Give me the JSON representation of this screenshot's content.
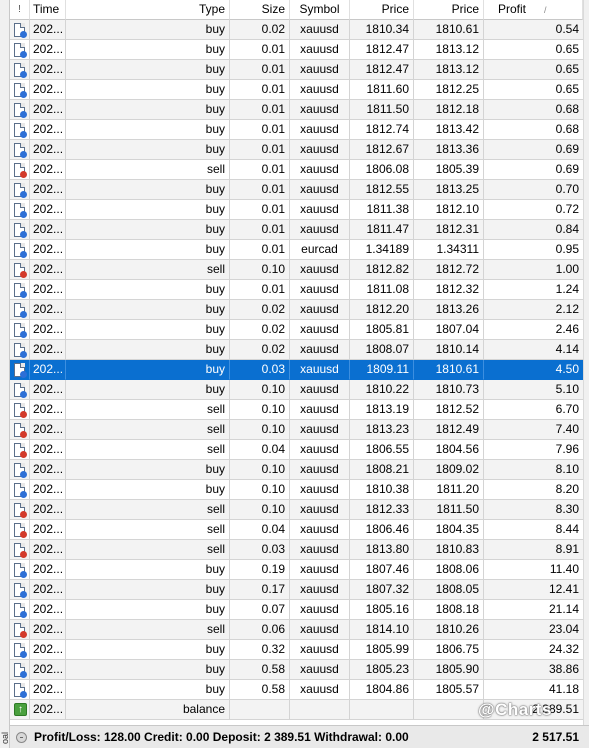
{
  "columns": {
    "icon": "!",
    "time": "Time",
    "type": "Type",
    "size": "Size",
    "symbol": "Symbol",
    "price_open": "Price",
    "price_close": "Price",
    "profit": "Profit"
  },
  "sort_indicator": "/",
  "selected_row_index": 17,
  "rows": [
    {
      "kind": "buy",
      "time": "202...",
      "type": "buy",
      "size": "0.02",
      "symbol": "xauusd",
      "price_open": "1810.34",
      "price_close": "1810.61",
      "profit": "0.54"
    },
    {
      "kind": "buy",
      "time": "202...",
      "type": "buy",
      "size": "0.01",
      "symbol": "xauusd",
      "price_open": "1812.47",
      "price_close": "1813.12",
      "profit": "0.65"
    },
    {
      "kind": "buy",
      "time": "202...",
      "type": "buy",
      "size": "0.01",
      "symbol": "xauusd",
      "price_open": "1812.47",
      "price_close": "1813.12",
      "profit": "0.65"
    },
    {
      "kind": "buy",
      "time": "202...",
      "type": "buy",
      "size": "0.01",
      "symbol": "xauusd",
      "price_open": "1811.60",
      "price_close": "1812.25",
      "profit": "0.65"
    },
    {
      "kind": "buy",
      "time": "202...",
      "type": "buy",
      "size": "0.01",
      "symbol": "xauusd",
      "price_open": "1811.50",
      "price_close": "1812.18",
      "profit": "0.68"
    },
    {
      "kind": "buy",
      "time": "202...",
      "type": "buy",
      "size": "0.01",
      "symbol": "xauusd",
      "price_open": "1812.74",
      "price_close": "1813.42",
      "profit": "0.68"
    },
    {
      "kind": "buy",
      "time": "202...",
      "type": "buy",
      "size": "0.01",
      "symbol": "xauusd",
      "price_open": "1812.67",
      "price_close": "1813.36",
      "profit": "0.69"
    },
    {
      "kind": "sell",
      "time": "202...",
      "type": "sell",
      "size": "0.01",
      "symbol": "xauusd",
      "price_open": "1806.08",
      "price_close": "1805.39",
      "profit": "0.69"
    },
    {
      "kind": "buy",
      "time": "202...",
      "type": "buy",
      "size": "0.01",
      "symbol": "xauusd",
      "price_open": "1812.55",
      "price_close": "1813.25",
      "profit": "0.70"
    },
    {
      "kind": "buy",
      "time": "202...",
      "type": "buy",
      "size": "0.01",
      "symbol": "xauusd",
      "price_open": "1811.38",
      "price_close": "1812.10",
      "profit": "0.72"
    },
    {
      "kind": "buy",
      "time": "202...",
      "type": "buy",
      "size": "0.01",
      "symbol": "xauusd",
      "price_open": "1811.47",
      "price_close": "1812.31",
      "profit": "0.84"
    },
    {
      "kind": "buy",
      "time": "202...",
      "type": "buy",
      "size": "0.01",
      "symbol": "eurcad",
      "price_open": "1.34189",
      "price_close": "1.34311",
      "profit": "0.95"
    },
    {
      "kind": "sell",
      "time": "202...",
      "type": "sell",
      "size": "0.10",
      "symbol": "xauusd",
      "price_open": "1812.82",
      "price_close": "1812.72",
      "profit": "1.00"
    },
    {
      "kind": "buy",
      "time": "202...",
      "type": "buy",
      "size": "0.01",
      "symbol": "xauusd",
      "price_open": "1811.08",
      "price_close": "1812.32",
      "profit": "1.24"
    },
    {
      "kind": "buy",
      "time": "202...",
      "type": "buy",
      "size": "0.02",
      "symbol": "xauusd",
      "price_open": "1812.20",
      "price_close": "1813.26",
      "profit": "2.12"
    },
    {
      "kind": "buy",
      "time": "202...",
      "type": "buy",
      "size": "0.02",
      "symbol": "xauusd",
      "price_open": "1805.81",
      "price_close": "1807.04",
      "profit": "2.46"
    },
    {
      "kind": "buy",
      "time": "202...",
      "type": "buy",
      "size": "0.02",
      "symbol": "xauusd",
      "price_open": "1808.07",
      "price_close": "1810.14",
      "profit": "4.14"
    },
    {
      "kind": "buy",
      "time": "202...",
      "type": "buy",
      "size": "0.03",
      "symbol": "xauusd",
      "price_open": "1809.11",
      "price_close": "1810.61",
      "profit": "4.50"
    },
    {
      "kind": "buy",
      "time": "202...",
      "type": "buy",
      "size": "0.10",
      "symbol": "xauusd",
      "price_open": "1810.22",
      "price_close": "1810.73",
      "profit": "5.10"
    },
    {
      "kind": "sell",
      "time": "202...",
      "type": "sell",
      "size": "0.10",
      "symbol": "xauusd",
      "price_open": "1813.19",
      "price_close": "1812.52",
      "profit": "6.70"
    },
    {
      "kind": "sell",
      "time": "202...",
      "type": "sell",
      "size": "0.10",
      "symbol": "xauusd",
      "price_open": "1813.23",
      "price_close": "1812.49",
      "profit": "7.40"
    },
    {
      "kind": "sell",
      "time": "202...",
      "type": "sell",
      "size": "0.04",
      "symbol": "xauusd",
      "price_open": "1806.55",
      "price_close": "1804.56",
      "profit": "7.96"
    },
    {
      "kind": "buy",
      "time": "202...",
      "type": "buy",
      "size": "0.10",
      "symbol": "xauusd",
      "price_open": "1808.21",
      "price_close": "1809.02",
      "profit": "8.10"
    },
    {
      "kind": "buy",
      "time": "202...",
      "type": "buy",
      "size": "0.10",
      "symbol": "xauusd",
      "price_open": "1810.38",
      "price_close": "1811.20",
      "profit": "8.20"
    },
    {
      "kind": "sell",
      "time": "202...",
      "type": "sell",
      "size": "0.10",
      "symbol": "xauusd",
      "price_open": "1812.33",
      "price_close": "1811.50",
      "profit": "8.30"
    },
    {
      "kind": "sell",
      "time": "202...",
      "type": "sell",
      "size": "0.04",
      "symbol": "xauusd",
      "price_open": "1806.46",
      "price_close": "1804.35",
      "profit": "8.44"
    },
    {
      "kind": "sell",
      "time": "202...",
      "type": "sell",
      "size": "0.03",
      "symbol": "xauusd",
      "price_open": "1813.80",
      "price_close": "1810.83",
      "profit": "8.91"
    },
    {
      "kind": "buy",
      "time": "202...",
      "type": "buy",
      "size": "0.19",
      "symbol": "xauusd",
      "price_open": "1807.46",
      "price_close": "1808.06",
      "profit": "11.40"
    },
    {
      "kind": "buy",
      "time": "202...",
      "type": "buy",
      "size": "0.17",
      "symbol": "xauusd",
      "price_open": "1807.32",
      "price_close": "1808.05",
      "profit": "12.41"
    },
    {
      "kind": "buy",
      "time": "202...",
      "type": "buy",
      "size": "0.07",
      "symbol": "xauusd",
      "price_open": "1805.16",
      "price_close": "1808.18",
      "profit": "21.14"
    },
    {
      "kind": "sell",
      "time": "202...",
      "type": "sell",
      "size": "0.06",
      "symbol": "xauusd",
      "price_open": "1814.10",
      "price_close": "1810.26",
      "profit": "23.04"
    },
    {
      "kind": "buy",
      "time": "202...",
      "type": "buy",
      "size": "0.32",
      "symbol": "xauusd",
      "price_open": "1805.99",
      "price_close": "1806.75",
      "profit": "24.32"
    },
    {
      "kind": "buy",
      "time": "202...",
      "type": "buy",
      "size": "0.58",
      "symbol": "xauusd",
      "price_open": "1805.23",
      "price_close": "1805.90",
      "profit": "38.86"
    },
    {
      "kind": "buy",
      "time": "202...",
      "type": "buy",
      "size": "0.58",
      "symbol": "xauusd",
      "price_open": "1804.86",
      "price_close": "1805.57",
      "profit": "41.18"
    },
    {
      "kind": "balance",
      "time": "202...",
      "type": "balance",
      "size": "",
      "symbol": "",
      "price_open": "",
      "price_close": "",
      "profit": "2 389.51"
    }
  ],
  "footer": {
    "summary": "Profit/Loss: 128.00  Credit: 0.00  Deposit: 2 389.51  Withdrawal: 0.00",
    "total": "2 517.51"
  },
  "watermark": "@Charts",
  "side_label": "oal",
  "colors": {
    "selection": "#0a6fd0",
    "buy_icon": "#2d6fd6",
    "sell_icon": "#d33a2a",
    "balance_icon": "#4aa03e"
  },
  "icons": {
    "buy": "buy-deal-icon",
    "sell": "sell-deal-icon",
    "balance": "balance-arrow-icon"
  }
}
